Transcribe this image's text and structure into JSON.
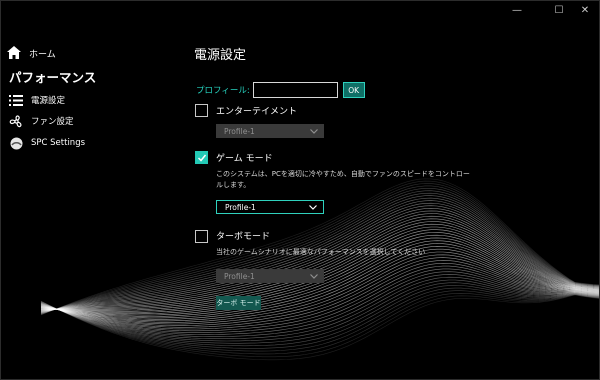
{
  "window": {
    "controls": {
      "minimize": "—",
      "maximize": "☐",
      "close": "✕"
    }
  },
  "sidebar": {
    "home_label": "ホーム",
    "section_title": "パフォーマンス",
    "items": [
      {
        "label": "電源設定",
        "icon": "list-icon"
      },
      {
        "label": "ファン設定",
        "icon": "fan-icon"
      },
      {
        "label": "SPC Settings",
        "icon": "spc-circle-icon"
      }
    ]
  },
  "main": {
    "page_title": "電源設定",
    "profile": {
      "label": "プロフィール:",
      "value": "",
      "ok_label": "OK"
    },
    "options": [
      {
        "label": "エンターテイメント",
        "checked": false,
        "dropdown": "Profile-1",
        "dropdown_enabled": false
      },
      {
        "label": "ゲーム モード",
        "checked": true,
        "description_line1": "このシステムは、PCを適切に冷やすため、自動でファンのスピードをコントロー",
        "description_line2": "ルします。",
        "dropdown": "Profile-1",
        "dropdown_enabled": true
      },
      {
        "label": "ターボモード",
        "checked": false,
        "description": "当社のゲームシナリオに最適なパフォーマンスを選択してください",
        "dropdown": "Profile-1",
        "dropdown_enabled": false,
        "button_label": "ターボ モード"
      }
    ]
  },
  "colors": {
    "accent": "#23c9b5",
    "background": "#000000",
    "disabled": "#3a3a3a"
  }
}
